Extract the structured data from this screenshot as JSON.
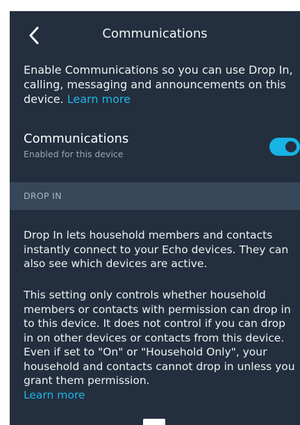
{
  "header": {
    "title": "Communications",
    "back_icon": "chevron-left-icon"
  },
  "intro": {
    "text": "Enable Communications so you can use Drop In, calling, messaging and announcements on this device. ",
    "link": "Learn more"
  },
  "communications_setting": {
    "title": "Communications",
    "subtitle": "Enabled for this device",
    "enabled": true
  },
  "drop_in": {
    "section_label": "DROP IN",
    "paragraph1": "Drop In lets household members and contacts instantly connect to your Echo devices. They can also see which devices are active.",
    "paragraph2": "This setting only controls whether household members or contacts with permission can drop in to this device. It does not control if you can drop in on other devices or contacts from this device. Even if set to \"On\" or \"Household Only\", your household and contacts cannot drop in unless you grant them permission.",
    "link": "Learn more"
  },
  "colors": {
    "background": "#232f3e",
    "section_band": "#37475a",
    "accent": "#1fb5e6",
    "toggle_on": "#17b3e6"
  }
}
